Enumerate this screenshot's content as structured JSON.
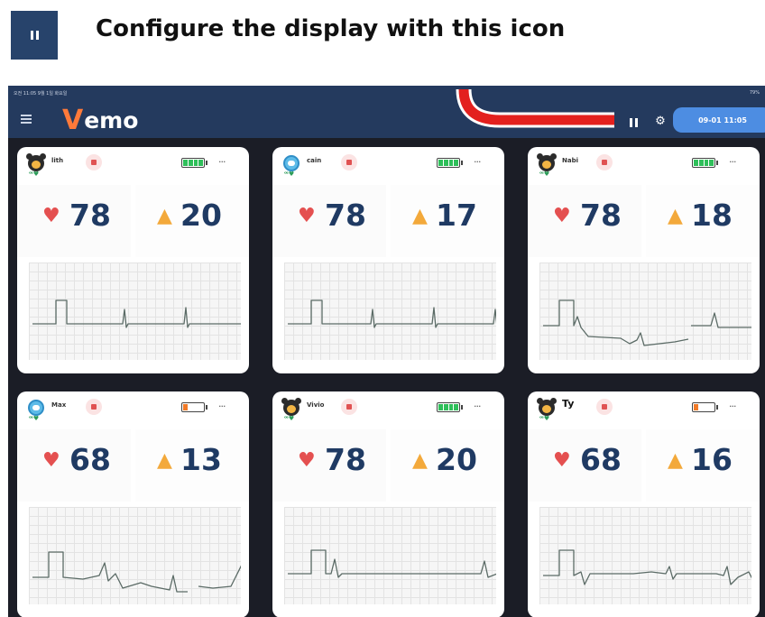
{
  "header": {
    "title": "Configure the display with this icon",
    "icon": "pause-icon"
  },
  "tablet": {
    "status_left": "오전 11:05  9월 1일 화요일",
    "status_right": "79%",
    "app_name": "Vemo",
    "app_logo_first": "V",
    "app_logo_rest": "emo",
    "datetime": "09-01 11:05"
  },
  "colors": {
    "appbar": "#243a5e",
    "datetime_pill": "#4d8de2",
    "heart": "#e45050",
    "lungs": "#f3a93b",
    "value_text": "#1f3a63",
    "arrow": "#e3201e",
    "battery_full": "#2fbf5a",
    "battery_low": "#f07a28"
  },
  "patients": [
    {
      "name": "lith",
      "heart_rate": "78",
      "resp_rate": "20",
      "avatar": "bear",
      "battery": "full"
    },
    {
      "name": "cain",
      "heart_rate": "78",
      "resp_rate": "17",
      "avatar": "robot",
      "battery": "full"
    },
    {
      "name": "Nabi",
      "heart_rate": "78",
      "resp_rate": "18",
      "avatar": "bear",
      "battery": "full"
    },
    {
      "name": "Max",
      "heart_rate": "68",
      "resp_rate": "13",
      "avatar": "robot",
      "battery": "low"
    },
    {
      "name": "Vivio",
      "heart_rate": "78",
      "resp_rate": "20",
      "avatar": "bear",
      "battery": "full"
    },
    {
      "name": "Ty",
      "heart_rate": "68",
      "resp_rate": "16",
      "avatar": "bear",
      "battery": "low"
    }
  ]
}
